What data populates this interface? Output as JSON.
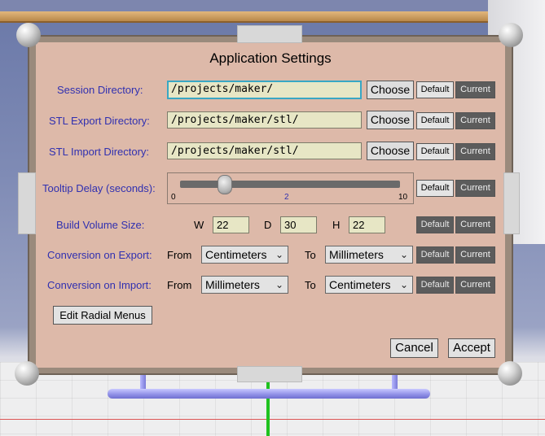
{
  "dialog": {
    "title": "Application Settings"
  },
  "session_dir": {
    "label": "Session Directory:",
    "value": "/projects/maker/",
    "choose": "Choose",
    "default": "Default",
    "current": "Current"
  },
  "stl_export_dir": {
    "label": "STL Export Directory:",
    "value": "/projects/maker/stl/",
    "choose": "Choose",
    "default": "Default",
    "current": "Current"
  },
  "stl_import_dir": {
    "label": "STL Import Directory:",
    "value": "/projects/maker/stl/",
    "choose": "Choose",
    "default": "Default",
    "current": "Current"
  },
  "tooltip_delay": {
    "label": "Tooltip Delay (seconds):",
    "min": "0",
    "value": "2",
    "max": "10",
    "default": "Default",
    "current": "Current"
  },
  "build_volume": {
    "label": "Build Volume Size:",
    "w_label": "W",
    "w_value": "22",
    "d_label": "D",
    "d_value": "30",
    "h_label": "H",
    "h_value": "22",
    "default": "Default",
    "current": "Current"
  },
  "conversion_export": {
    "label": "Conversion on Export:",
    "from_label": "From",
    "from_value": "Centimeters",
    "to_label": "To",
    "to_value": "Millimeters",
    "default": "Default",
    "current": "Current"
  },
  "conversion_import": {
    "label": "Conversion on Import:",
    "from_label": "From",
    "from_value": "Millimeters",
    "to_label": "To",
    "to_value": "Centimeters",
    "default": "Default",
    "current": "Current"
  },
  "buttons": {
    "edit_radial_menus": "Edit Radial Menus",
    "cancel": "Cancel",
    "accept": "Accept"
  },
  "icons": {
    "dropdown": "chevron-down-icon",
    "dropdown_glyph": "⌄"
  },
  "colors": {
    "panel": "#ddb9a9",
    "label_text": "#3030b0",
    "field_bg": "#e7e6c5",
    "active_border": "#39a7c4",
    "dark_button": "#5c5c5c"
  }
}
